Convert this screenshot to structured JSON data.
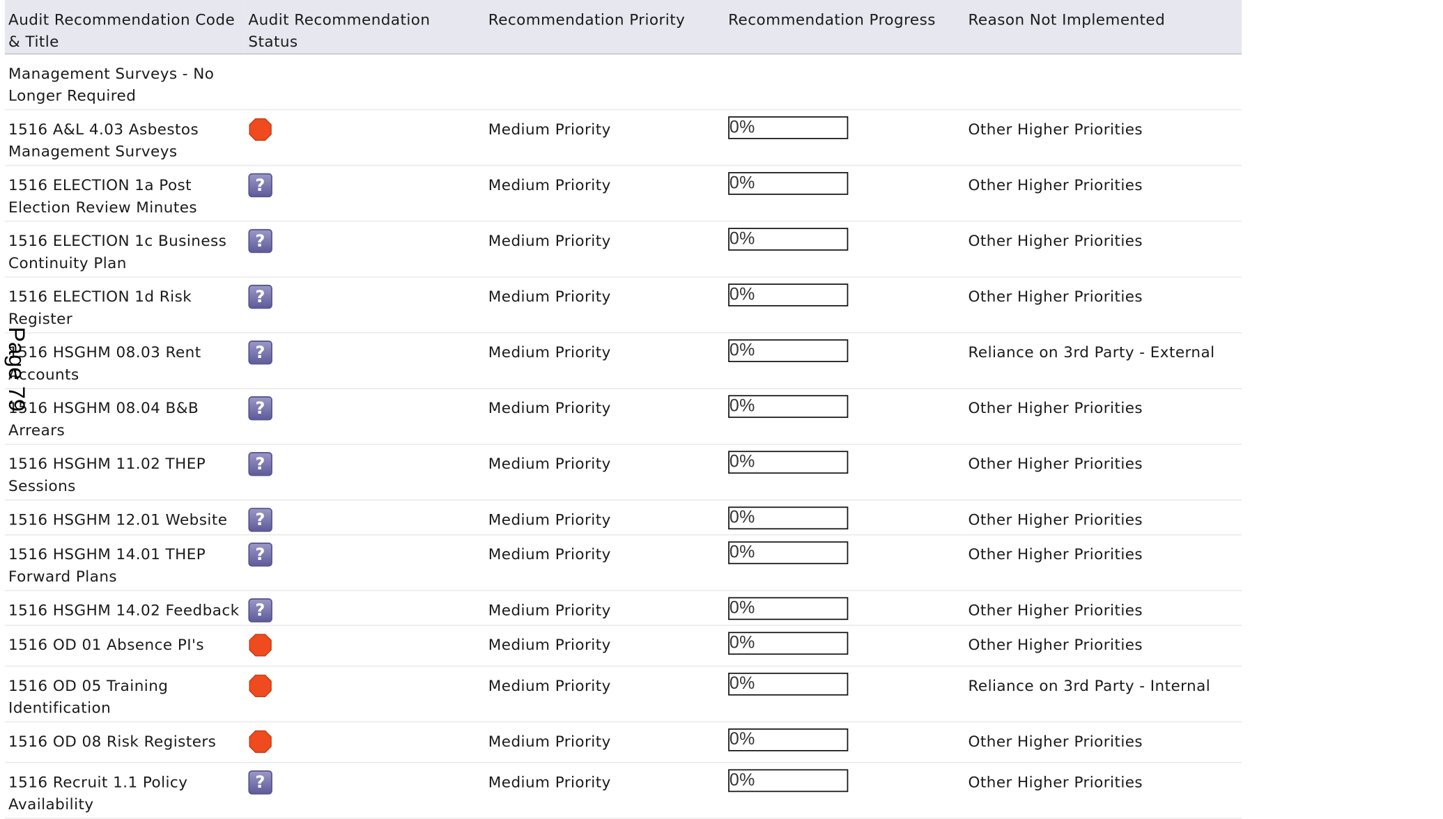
{
  "columns": [
    "Audit Recommendation Code & Title",
    "Audit Recommendation Status",
    "Recommendation Priority",
    "Recommendation Progress",
    "Reason Not Implemented"
  ],
  "page_marker": "Page 79",
  "status_icons": {
    "stop": "stop-octagon-icon",
    "unknown": "question-mark-icon"
  },
  "colors": {
    "stop": "#ef4b1e",
    "header_bg": "#e6e7ef",
    "question_bg": "#7a77b0"
  },
  "partial_row": {
    "title": "Management Surveys - No Longer Required"
  },
  "rows": [
    {
      "title": "1516 A&L 4.03 Asbestos Management Surveys",
      "status": "stop",
      "priority": "Medium Priority",
      "progress": "0%",
      "progress_value": 0,
      "reason": "Other Higher Priorities"
    },
    {
      "title": "1516 ELECTION 1a Post Election Review Minutes",
      "status": "unknown",
      "priority": "Medium Priority",
      "progress": "0%",
      "progress_value": 0,
      "reason": "Other Higher Priorities"
    },
    {
      "title": "1516 ELECTION 1c Business Continuity Plan",
      "status": "unknown",
      "priority": "Medium Priority",
      "progress": "0%",
      "progress_value": 0,
      "reason": "Other Higher Priorities"
    },
    {
      "title": "1516 ELECTION 1d Risk Register",
      "status": "unknown",
      "priority": "Medium Priority",
      "progress": "0%",
      "progress_value": 0,
      "reason": "Other Higher Priorities"
    },
    {
      "title": "1516 HSGHM 08.03 Rent Accounts",
      "status": "unknown",
      "priority": "Medium Priority",
      "progress": "0%",
      "progress_value": 0,
      "reason": "Reliance on 3rd Party - External"
    },
    {
      "title": "1516 HSGHM 08.04 B&B Arrears",
      "status": "unknown",
      "priority": "Medium Priority",
      "progress": "0%",
      "progress_value": 0,
      "reason": "Other Higher Priorities"
    },
    {
      "title": "1516 HSGHM 11.02 THEP Sessions",
      "status": "unknown",
      "priority": "Medium Priority",
      "progress": "0%",
      "progress_value": 0,
      "reason": "Other Higher Priorities"
    },
    {
      "title": "1516 HSGHM 12.01 Website",
      "status": "unknown",
      "priority": "Medium Priority",
      "progress": "0%",
      "progress_value": 0,
      "reason": "Other Higher Priorities"
    },
    {
      "title": "1516 HSGHM 14.01 THEP Forward Plans",
      "status": "unknown",
      "priority": "Medium Priority",
      "progress": "0%",
      "progress_value": 0,
      "reason": "Other Higher Priorities"
    },
    {
      "title": "1516 HSGHM 14.02 Feedback",
      "status": "unknown",
      "priority": "Medium Priority",
      "progress": "0%",
      "progress_value": 0,
      "reason": "Other Higher Priorities"
    },
    {
      "title": "1516 OD 01 Absence PI's",
      "status": "stop",
      "priority": "Medium Priority",
      "progress": "0%",
      "progress_value": 0,
      "reason": "Other Higher Priorities"
    },
    {
      "title": "1516 OD 05 Training Identification",
      "status": "stop",
      "priority": "Medium Priority",
      "progress": "0%",
      "progress_value": 0,
      "reason": "Reliance on 3rd Party - Internal"
    },
    {
      "title": "1516 OD 08 Risk Registers",
      "status": "stop",
      "priority": "Medium Priority",
      "progress": "0%",
      "progress_value": 0,
      "reason": "Other Higher Priorities"
    },
    {
      "title": "1516 Recruit 1.1 Policy Availability",
      "status": "unknown",
      "priority": "Medium Priority",
      "progress": "0%",
      "progress_value": 0,
      "reason": "Other Higher Priorities"
    }
  ]
}
